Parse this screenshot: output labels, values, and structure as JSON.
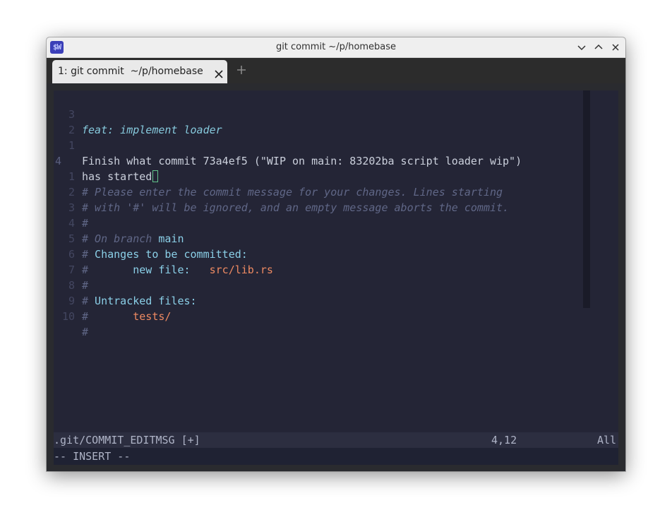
{
  "window": {
    "title": "git commit ~/p/homebase",
    "app_icon_label": "$W"
  },
  "tabs": [
    {
      "label": "1: git commit  ~/p/homebase",
      "active": true
    }
  ],
  "editor": {
    "lines": [
      {
        "num": "3",
        "text": "feat: implement loader"
      },
      {
        "num": "2",
        "text": ""
      },
      {
        "num": "1",
        "text": "Finish what commit 73a4ef5 (\"WIP on main: 83202ba script loader wip\")"
      },
      {
        "num": "4",
        "text": "has started"
      },
      {
        "num": "1",
        "text": "# Please enter the commit message for your changes. Lines starting"
      },
      {
        "num": "2",
        "text": "# with '#' will be ignored, and an empty message aborts the commit."
      },
      {
        "num": "3",
        "text": "#"
      },
      {
        "num": "4",
        "hash": "#",
        "comment": " On branch ",
        "branch": "main"
      },
      {
        "num": "5",
        "hash": "#",
        "heading": " Changes to be committed:"
      },
      {
        "num": "6",
        "hash": "#",
        "indent": "       ",
        "label": "new file:",
        "gap": "   ",
        "file": "src/lib.rs"
      },
      {
        "num": "7",
        "text": "#"
      },
      {
        "num": "8",
        "hash": "#",
        "heading": " Untracked files:"
      },
      {
        "num": "9",
        "hash": "#",
        "indent": "       ",
        "file": "tests/"
      },
      {
        "num": "10",
        "text": "#"
      }
    ]
  },
  "statusline": {
    "filename": ".git/COMMIT_EDITMSG [+]",
    "position": "4,12",
    "scroll": "All"
  },
  "mode": "-- INSERT --",
  "colors": {
    "background": "#242536",
    "comment": "#606787",
    "keyword": "#8bd0e8",
    "file": "#ee8a62",
    "cursor": "#62c28a"
  }
}
